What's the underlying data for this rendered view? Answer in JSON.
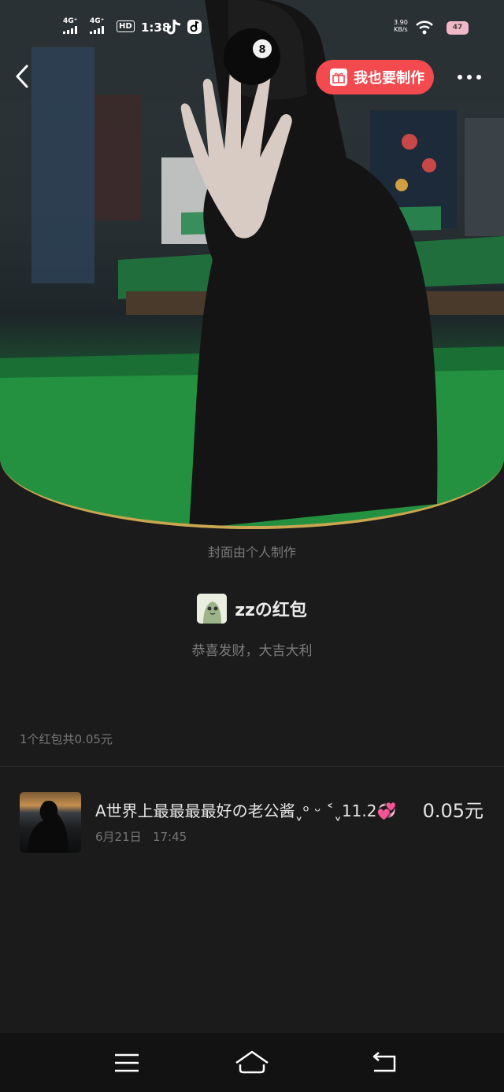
{
  "status_bar": {
    "sim1": "4G⁺",
    "sim2": "4G⁺",
    "hd": "HD",
    "time": "1:38",
    "net_speed": "3.90",
    "net_unit": "KB/s",
    "battery": "47"
  },
  "header": {
    "make_label": "我也要制作"
  },
  "cover_note": "封面由个人制作",
  "packet": {
    "title": "zzの红包",
    "wish": "恭喜发财，大吉大利"
  },
  "summary": "1个红包共0.05元",
  "records": [
    {
      "name": "A世界上最最最最好の老公酱ˬᵒ ᵕ ˂ˬ11.2",
      "emoji": "💞",
      "amount": "0.05元",
      "date": "6月21日",
      "time": "17:45"
    }
  ],
  "colors": {
    "accent_button": "#f34a4f",
    "cover_border": "#c9a64f",
    "background": "#1b1b1b"
  },
  "icons": {
    "back": "chevron-left-icon",
    "gift": "gift-icon",
    "more": "more-dots-icon",
    "menu": "menu-icon",
    "home": "home-icon",
    "return": "return-icon"
  }
}
